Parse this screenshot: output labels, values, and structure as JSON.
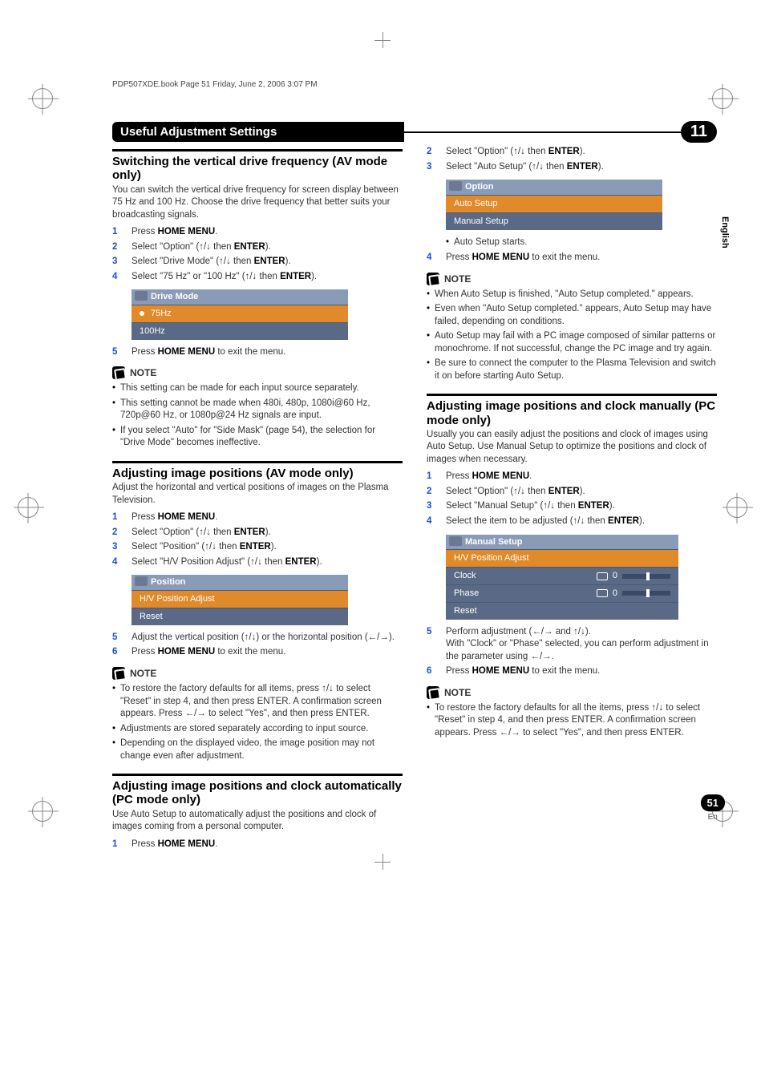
{
  "header_line": "PDP507XDE.book  Page 51  Friday, June 2, 2006  3:07 PM",
  "chapter": {
    "title": "Useful Adjustment Settings",
    "number": "11"
  },
  "side_tab": "English",
  "page_footer": {
    "num": "51",
    "lang": "En"
  },
  "left": {
    "sec1": {
      "title": "Switching the vertical drive frequency (AV mode only)",
      "intro": "You can switch the vertical drive frequency for screen display between 75 Hz and 100 Hz. Choose the drive frequency that better suits your broadcasting signals.",
      "steps": [
        {
          "n": "1",
          "t_pre": "Press ",
          "b": "HOME MENU",
          "t_post": "."
        },
        {
          "n": "2",
          "t_pre": "Select \"Option\" (",
          "arrows": "↑/↓",
          "t_mid": " then ",
          "b": "ENTER",
          "t_post": ")."
        },
        {
          "n": "3",
          "t_pre": "Select \"Drive Mode\" (",
          "arrows": "↑/↓",
          "t_mid": " then ",
          "b": "ENTER",
          "t_post": ")."
        },
        {
          "n": "4",
          "t_pre": "Select \"75 Hz\" or \"100 Hz\" (",
          "arrows": "↑/↓",
          "t_mid": " then ",
          "b": "ENTER",
          "t_post": ")."
        }
      ],
      "menu": {
        "title": "Drive Mode",
        "rows": [
          "75Hz",
          "100Hz"
        ],
        "selected": 0
      },
      "step5": {
        "n": "5",
        "t_pre": "Press ",
        "b": "HOME MENU",
        "t_post": " to exit the menu."
      },
      "note_label": "NOTE",
      "notes": [
        "This setting can be made for each input source separately.",
        "This setting cannot be made when 480i, 480p, 1080i@60 Hz, 720p@60 Hz, or 1080p@24 Hz signals are input.",
        "If you select \"Auto\" for \"Side Mask\" (page 54), the selection for \"Drive Mode\" becomes ineffective."
      ]
    },
    "sec2": {
      "title": "Adjusting image positions (AV mode only)",
      "intro": "Adjust the horizontal and vertical positions of images on the Plasma Television.",
      "steps": [
        {
          "n": "1",
          "t_pre": "Press ",
          "b": "HOME MENU",
          "t_post": "."
        },
        {
          "n": "2",
          "t_pre": "Select \"Option\" (",
          "arrows": "↑/↓",
          "t_mid": " then ",
          "b": "ENTER",
          "t_post": ")."
        },
        {
          "n": "3",
          "t_pre": "Select \"Position\" (",
          "arrows": "↑/↓",
          "t_mid": " then ",
          "b": "ENTER",
          "t_post": ")."
        },
        {
          "n": "4",
          "t_pre": "Select \"H/V Position Adjust\" (",
          "arrows": "↑/↓",
          "t_mid": " then ",
          "b": "ENTER",
          "t_post": ")."
        }
      ],
      "menu": {
        "title": "Position",
        "rows": [
          "H/V Position Adjust",
          "Reset"
        ],
        "selected": 0
      },
      "step5": {
        "n": "5",
        "plain": "Adjust the vertical position (↑/↓) or the horizontal position  (←/→)."
      },
      "step6": {
        "n": "6",
        "t_pre": "Press ",
        "b": "HOME MENU",
        "t_post": " to exit the menu."
      },
      "note_label": "NOTE",
      "notes": [
        "To restore the factory defaults for all items, press ↑/↓ to select \"Reset\" in step 4, and then press ENTER. A confirmation screen appears. Press ←/→ to select \"Yes\", and then press ENTER.",
        "Adjustments are stored separately according to input source.",
        "Depending on the displayed video, the image position may not change even after adjustment."
      ]
    },
    "sec3": {
      "title": "Adjusting image positions and clock automatically (PC mode only)",
      "intro": "Use Auto Setup to automatically adjust the positions and clock of images coming from a personal computer.",
      "steps": [
        {
          "n": "1",
          "t_pre": "Press ",
          "b": "HOME MENU",
          "t_post": "."
        }
      ]
    }
  },
  "right": {
    "top_steps": [
      {
        "n": "2",
        "t_pre": "Select \"Option\" (",
        "arrows": "↑/↓",
        "t_mid": " then ",
        "b": "ENTER",
        "t_post": ")."
      },
      {
        "n": "3",
        "t_pre": "Select \"Auto Setup\" (",
        "arrows": "↑/↓",
        "t_mid": " then ",
        "b": "ENTER",
        "t_post": ")."
      }
    ],
    "menu1": {
      "title": "Option",
      "rows": [
        "Auto Setup",
        "Manual Setup"
      ],
      "selected": 0
    },
    "after_menu_bullet": "Auto Setup starts.",
    "step4": {
      "n": "4",
      "t_pre": "Press ",
      "b": "HOME MENU",
      "t_post": " to exit the menu."
    },
    "note_label": "NOTE",
    "notes1": [
      "When Auto Setup is finished, \"Auto Setup completed.\" appears.",
      "Even when \"Auto Setup completed.\" appears, Auto Setup may have failed, depending on conditions.",
      "Auto Setup may fail with a PC image composed of similar patterns or monochrome. If not successful, change the PC image and try again.",
      "Be sure to connect the computer to the Plasma Television and switch it on before starting Auto Setup."
    ],
    "sec2": {
      "title": "Adjusting image positions and clock manually (PC mode only)",
      "intro": "Usually you can easily adjust the positions and clock of images using Auto Setup. Use Manual Setup to optimize the positions and clock of images when necessary.",
      "steps": [
        {
          "n": "1",
          "t_pre": "Press ",
          "b": "HOME MENU",
          "t_post": "."
        },
        {
          "n": "2",
          "t_pre": "Select \"Option\" (",
          "arrows": "↑/↓",
          "t_mid": " then ",
          "b": "ENTER",
          "t_post": ")."
        },
        {
          "n": "3",
          "t_pre": "Select \"Manual Setup\" (",
          "arrows": "↑/↓",
          "t_mid": " then ",
          "b": "ENTER",
          "t_post": ")."
        },
        {
          "n": "4",
          "t_pre": "Select the item to be adjusted (",
          "arrows": "↑/↓",
          "t_mid": " then ",
          "b": "ENTER",
          "t_post": ")."
        }
      ],
      "menu": {
        "title": "Manual Setup",
        "rows": [
          {
            "label": "H/V Position Adjust"
          },
          {
            "label": "Clock",
            "value": "0",
            "slider": true,
            "icon": "clock"
          },
          {
            "label": "Phase",
            "value": "0",
            "slider": true,
            "icon": "phase"
          },
          {
            "label": "Reset"
          }
        ],
        "selected": 0
      },
      "step5": {
        "n": "5",
        "plain": "Perform adjustment (←/→ and ↑/↓).\nWith \"Clock\" or \"Phase\" selected, you can perform adjustment in the parameter using ←/→."
      },
      "step6": {
        "n": "6",
        "t_pre": "Press ",
        "b": "HOME MENU",
        "t_post": " to exit the menu."
      },
      "note_label": "NOTE",
      "notes": [
        "To restore the factory defaults for all the items, press ↑/↓ to select \"Reset\" in step 4, and then press ENTER. A confirmation screen appears. Press ←/→ to select \"Yes\", and then press ENTER."
      ]
    }
  }
}
